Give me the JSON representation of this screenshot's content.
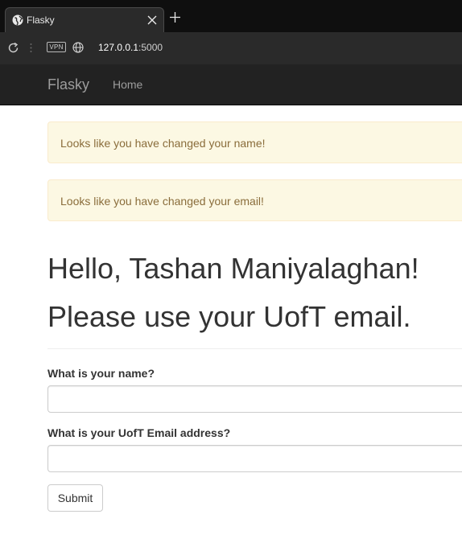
{
  "browser": {
    "tab_title": "Flasky",
    "vpn_label": "VPN",
    "url_host": "127.0.0.1",
    "url_port": ":5000",
    "icons": {
      "tab_favicon": "globe-icon",
      "tab_close": "close-icon",
      "new_tab": "plus-icon",
      "reload": "reload-icon",
      "menu": "dots-icon",
      "site_info": "globe-icon"
    }
  },
  "navbar": {
    "brand": "Flasky",
    "home_link": "Home"
  },
  "alerts": [
    "Looks like you have changed your name!",
    "Looks like you have changed your email!"
  ],
  "page": {
    "greeting": "Hello, Tashan Maniyalaghan!",
    "notice": "Please use your UofT email."
  },
  "form": {
    "name_label": "What is your name?",
    "name_value": "",
    "email_label": "What is your UofT Email address?",
    "email_value": "",
    "submit_label": "Submit"
  },
  "colors": {
    "navbar_bg": "#222222",
    "alert_bg": "#fcf8e3",
    "alert_text": "#8a6d3b",
    "browser_chrome": "#2a2a2a"
  }
}
